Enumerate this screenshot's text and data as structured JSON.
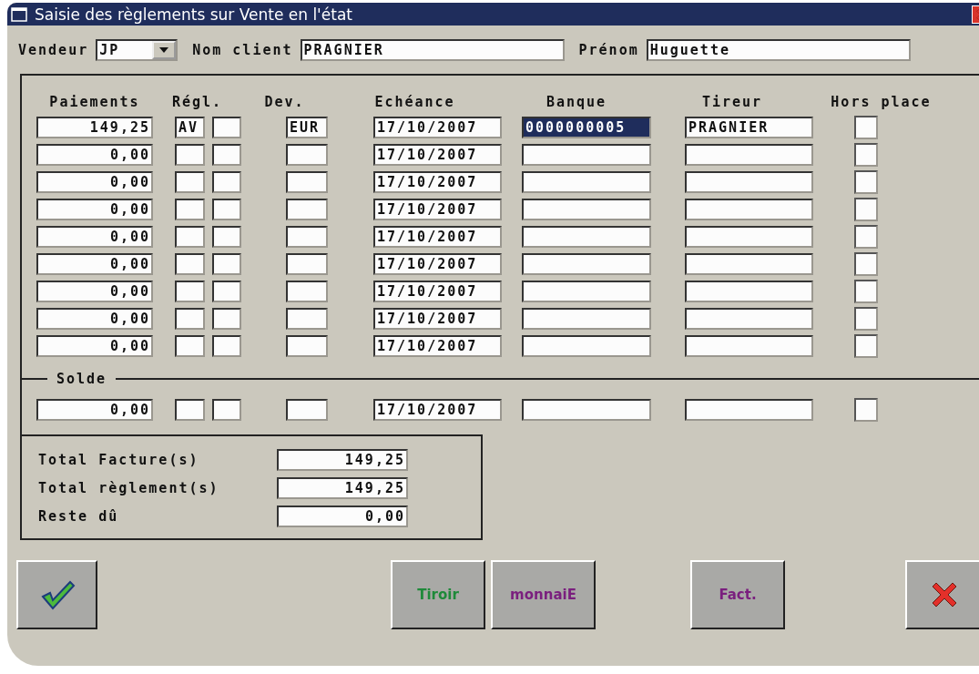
{
  "window": {
    "title": "Saisie des règlements sur Vente en l'état"
  },
  "header": {
    "vendeur": {
      "label": "Vendeur",
      "value": "JP"
    },
    "nom": {
      "label": "Nom client",
      "value": "PRAGNIER"
    },
    "prenom": {
      "label": "Prénom",
      "value": "Huguette"
    }
  },
  "columns": [
    "Paiements",
    "Régl.",
    "Dev.",
    "Echéance",
    "Banque",
    "Tireur",
    "Hors place"
  ],
  "rows": [
    {
      "paiement": "149,25",
      "regl_1": "AV",
      "dev": "EUR",
      "echeance": "17/10/2007",
      "banque": "0000000005",
      "selected": true,
      "tireur": "PRAGNIER",
      "hors_place": false
    },
    {
      "paiement": "0,00",
      "echeance": "17/10/2007",
      "selected": false,
      "hors_place": false
    },
    {
      "paiement": "0,00",
      "echeance": "17/10/2007",
      "selected": false,
      "hors_place": false
    },
    {
      "paiement": "0,00",
      "echeance": "17/10/2007",
      "selected": false,
      "hors_place": false
    },
    {
      "paiement": "0,00",
      "echeance": "17/10/2007",
      "selected": false,
      "hors_place": false
    },
    {
      "paiement": "0,00",
      "echeance": "17/10/2007",
      "selected": false,
      "hors_place": false
    },
    {
      "paiement": "0,00",
      "echeance": "17/10/2007",
      "selected": false,
      "hors_place": false
    },
    {
      "paiement": "0,00",
      "echeance": "17/10/2007",
      "selected": false,
      "hors_place": false
    },
    {
      "paiement": "0,00",
      "echeance": "17/10/2007",
      "selected": false,
      "hors_place": false
    }
  ],
  "solde": {
    "label": "Solde",
    "row": {
      "paiement": "0,00",
      "echeance": "17/10/2007",
      "selected": false,
      "hors_place": false
    }
  },
  "totals": [
    {
      "label": "Total Facture(s)",
      "value": "149,25"
    },
    {
      "label": "Total règlement(s)",
      "value": "149,25"
    },
    {
      "label": "Reste dû",
      "value": "0,00"
    }
  ],
  "buttons": [
    {
      "kind": "ok"
    },
    {
      "kind": "text",
      "label": "Tiroir",
      "color": "#1f8a3a"
    },
    {
      "kind": "text",
      "label": "monnaiE",
      "color": "#7a1f7e"
    },
    {
      "kind": "text",
      "label": "Fact.",
      "color": "#7a1f7e"
    },
    {
      "kind": "cancel"
    }
  ]
}
